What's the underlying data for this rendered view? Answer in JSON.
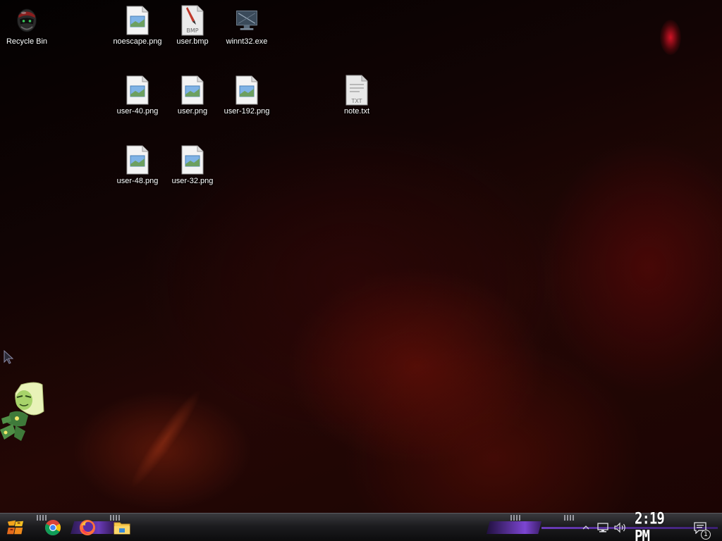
{
  "desktop": {
    "icons": [
      {
        "label": "Recycle Bin",
        "icon": "recycle-bin-helmet-icon"
      },
      {
        "label": "noescape.png",
        "icon": "image-file-icon"
      },
      {
        "label": "user.bmp",
        "icon": "bmp-file-icon"
      },
      {
        "label": "winnt32.exe",
        "icon": "monitor-exe-icon"
      },
      {
        "label": "user-40.png",
        "icon": "image-file-icon"
      },
      {
        "label": "user.png",
        "icon": "image-file-icon"
      },
      {
        "label": "user-192.png",
        "icon": "image-file-icon"
      },
      {
        "label": "note.txt",
        "icon": "text-file-icon"
      },
      {
        "label": "user-48.png",
        "icon": "image-file-icon"
      },
      {
        "label": "user-32.png",
        "icon": "image-file-icon"
      }
    ],
    "bmp_badge": "BMP",
    "txt_badge": "TXT"
  },
  "taskbar": {
    "start_icon": "start-button-icon",
    "pinned": [
      {
        "name": "chrome",
        "icon": "chrome-icon"
      },
      {
        "name": "firefox",
        "icon": "firefox-icon"
      },
      {
        "name": "file-explorer",
        "icon": "folder-icon"
      }
    ],
    "tray": {
      "overflow_icon": "chevron-up-icon",
      "network_icon": "network-icon",
      "volume_icon": "volume-icon",
      "clock": "2:19 PM",
      "notification_icon": "notification-icon",
      "notification_count": "1"
    }
  },
  "colors": {
    "accent_purple": "#6a3bb8",
    "chrome_red": "#db4437",
    "chrome_yellow": "#f4c20d",
    "chrome_green": "#0f9d58",
    "chrome_blue": "#4285f4",
    "firefox_orange": "#ff7139",
    "folder_yellow": "#f8c74a"
  }
}
